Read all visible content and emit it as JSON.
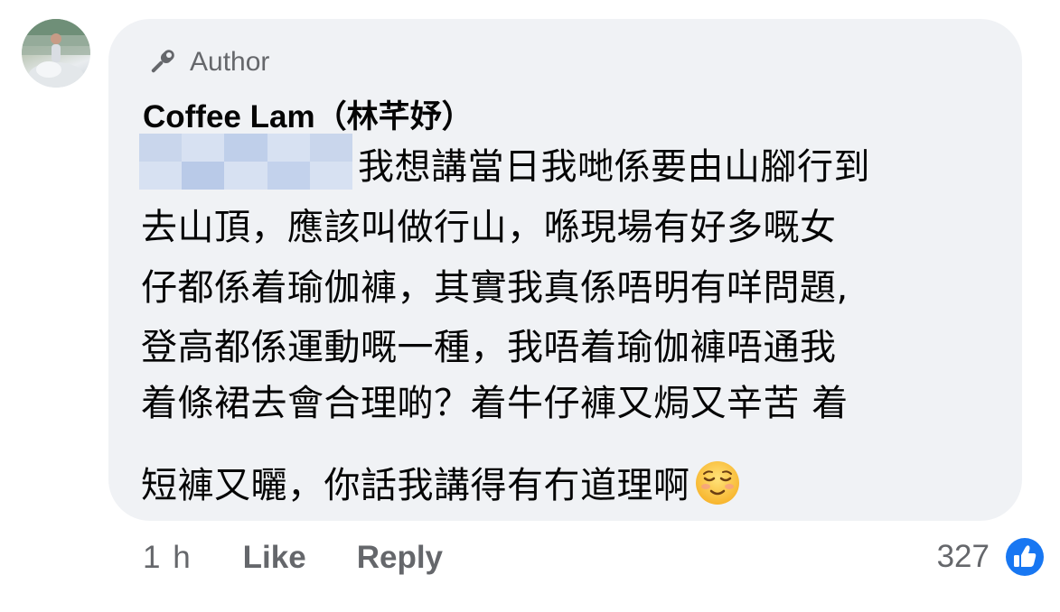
{
  "comment": {
    "badge_label": "Author",
    "author_name": "Coffee Lam（林芊妤）",
    "lines": [
      "我想講當日我哋係要由山腳行到",
      "去山頂，應該叫做行山，喺現場有好多嘅女",
      "仔都係着瑜伽褲，其實我真係唔明有咩問題,",
      "登高都係運動嘅一種，我唔着瑜伽褲唔通我",
      "着條裙去會合理啲？着牛仔褲又焗又辛苦 着",
      "短褲又曬，你話我講得有冇道理啊"
    ],
    "emoji_icon": "relieved-face-icon"
  },
  "meta": {
    "timestamp": "1 h",
    "like_label": "Like",
    "reply_label": "Reply"
  },
  "reactions": {
    "count": "327",
    "icon": "thumbs-up-icon",
    "badge_color": "#1877f2"
  },
  "colors": {
    "bubble_bg": "#f0f2f5",
    "secondary_text": "#65676b",
    "primary_text": "#050505"
  }
}
